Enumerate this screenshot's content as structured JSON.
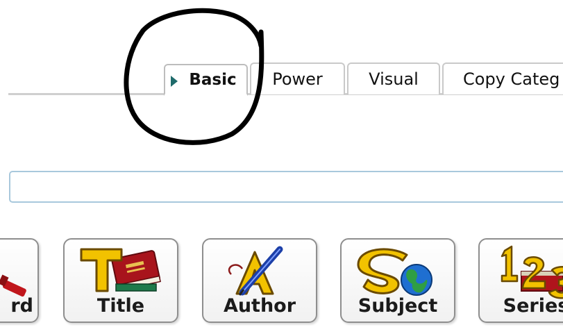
{
  "tabs": [
    {
      "label": "Basic",
      "active": true
    },
    {
      "label": "Power"
    },
    {
      "label": "Visual"
    },
    {
      "label": "Copy Categ"
    }
  ],
  "search": {
    "value": "",
    "placeholder": ""
  },
  "search_types": [
    {
      "label": "rd",
      "icon": "keyword-icon"
    },
    {
      "label": "Title",
      "icon": "title-book-icon"
    },
    {
      "label": "Author",
      "icon": "author-quill-icon"
    },
    {
      "label": "Subject",
      "icon": "subject-globe-icon"
    },
    {
      "label": "Series",
      "icon": "series-numbers-icon"
    }
  ],
  "colors": {
    "tab_arrow": "#1f6b6b",
    "search_border": "#a8c8dc",
    "annotation": "#000000",
    "icon_gold": "#f2c200"
  }
}
